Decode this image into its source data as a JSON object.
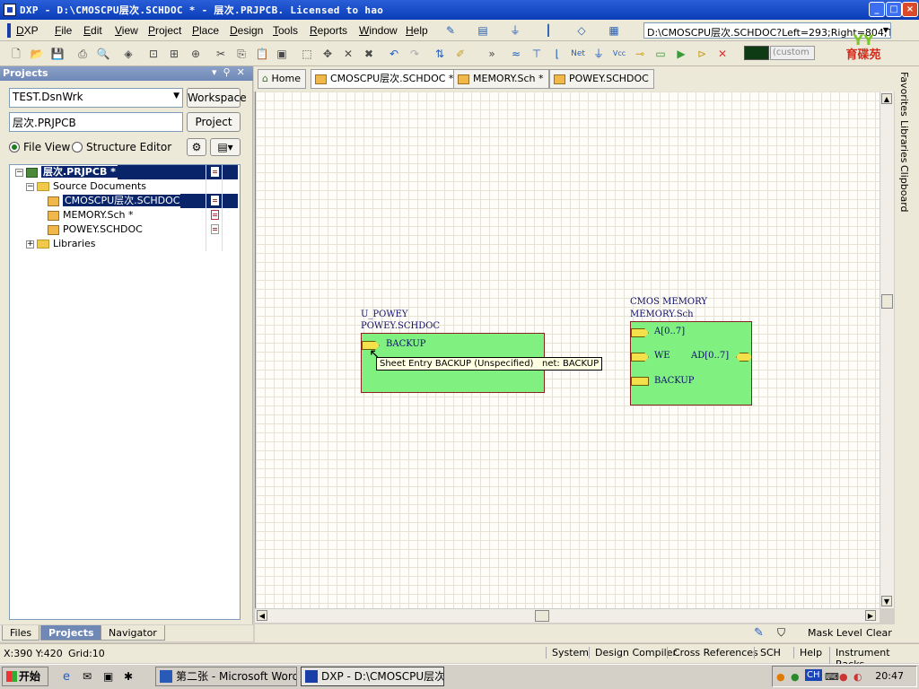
{
  "window": {
    "title": "DXP - D:\\CMOSCPU层次.SCHDOC * - 层次.PRJPCB. Licensed to hao",
    "btn_min": "_",
    "btn_max": "□",
    "btn_close": "×"
  },
  "menu": {
    "items": [
      "DXP",
      "File",
      "Edit",
      "View",
      "Project",
      "Place",
      "Design",
      "Tools",
      "Reports",
      "Window",
      "Help"
    ]
  },
  "toolbar": {
    "address": "D:\\CMOSCPU层次.SCHDOC?Left=293;Right=804;Top",
    "color_combo": "(custom",
    "logo_text": "育碟苑",
    "logo_mark": "YY"
  },
  "projects_panel": {
    "title": "Projects",
    "workspace_value": "TEST.DsnWrk",
    "workspace_button": "Workspace",
    "project_value": "层次.PRJPCB",
    "project_button": "Project",
    "radio_file_view": "File View",
    "radio_structure": "Structure Editor",
    "tree": {
      "project": "层次.PRJPCB *",
      "source_docs": "Source Documents",
      "docs": [
        "CMOSCPU层次.SCHDOC *",
        "MEMORY.Sch *",
        "POWEY.SCHDOC"
      ],
      "libraries": "Libraries"
    },
    "tabs": [
      "Files",
      "Projects",
      "Navigator"
    ]
  },
  "doc_tabs": [
    "Home",
    "CMOSCPU层次.SCHDOC *",
    "MEMORY.Sch *",
    "POWEY.SCHDOC"
  ],
  "schematic": {
    "sheet1": {
      "designator": "U_POWEY",
      "filename": "POWEY.SCHDOC",
      "entries": [
        "BACKUP"
      ]
    },
    "sheet2": {
      "designator": "CMOS MEMORY",
      "filename": "MEMORY.Sch",
      "entries": [
        "A[0..7]",
        "WE",
        "AD[0..7]",
        "BACKUP"
      ]
    },
    "tooltip_entry": "Sheet Entry BACKUP (Unspecified)",
    "tooltip_net": "net: BACKUP"
  },
  "right_panels": [
    "Favorites",
    "Libraries",
    "Clipboard"
  ],
  "mask": {
    "label": "Mask Level",
    "clear": "Clear"
  },
  "statusbar": {
    "coords": "X:390 Y:420",
    "grid": "Grid:10",
    "buttons": [
      "System",
      "Design Compiler",
      "Cross References",
      "SCH",
      "Help",
      "Instrument Racks"
    ]
  },
  "taskbar": {
    "start": "开始",
    "tasks": [
      "第二张 - Microsoft Word",
      "DXP - D:\\CMOSCPU层次...."
    ],
    "tray_lang": "CH",
    "clock": "20:47"
  }
}
